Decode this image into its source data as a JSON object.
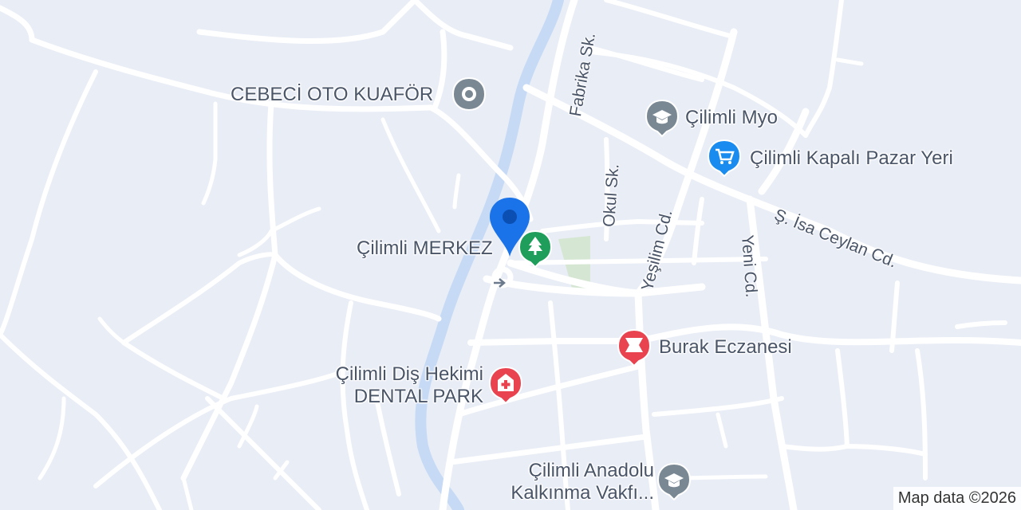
{
  "map": {
    "colors": {
      "background": "#e9edf6",
      "road": "#ffffff",
      "river": "#c6daf5",
      "park": "#d5e6d3",
      "label": "#4a5568",
      "pin": "#1a73e8"
    },
    "places": {
      "cebeci": "CEBECİ OTO KUAFÖR",
      "myo": "Çilimli Myo",
      "pazar": "Çilimli Kapalı Pazar Yeri",
      "merkez": "Çilimli MERKEZ",
      "eczane": "Burak Eczanesi",
      "dis_line1": "Çilimli Diş Hekimi",
      "dis_line2": "DENTAL PARK",
      "anadolu_line1": "Çilimli Anadolu",
      "anadolu_line2": "Kalkınma Vakfı..."
    },
    "streets": {
      "fabrika": "Fabrika Sk.",
      "okul": "Okul Sk.",
      "yesilim": "Yeşilim Cd.",
      "isa": "Ş. İsa Ceylan Cd.",
      "yeni": "Yeni Cd."
    },
    "icons": {
      "cebeci": "place-icon",
      "myo": "school-icon",
      "pazar": "shopping-cart-icon",
      "merkez": "park-tree-icon",
      "eczane": "pharmacy-icon",
      "dis": "hospital-icon",
      "anadolu": "school-icon",
      "pin": "location-pin-icon",
      "arrow": "direction-arrow-icon"
    },
    "attribution": "Map data ©2026"
  }
}
